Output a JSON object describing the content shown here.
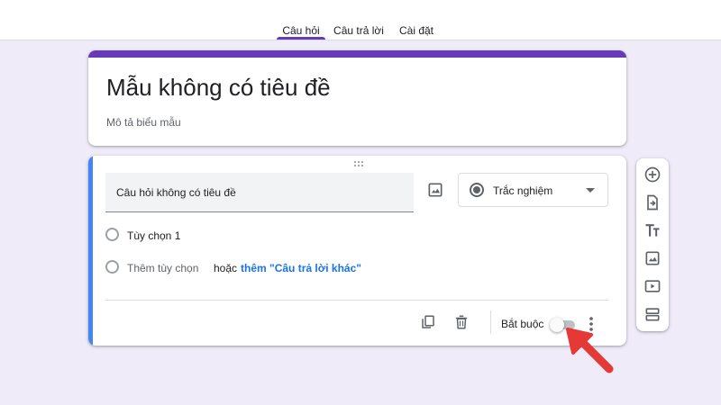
{
  "tabs": [
    {
      "label": "Câu hỏi",
      "active": true
    },
    {
      "label": "Câu trả lời",
      "active": false
    },
    {
      "label": "Cài đặt",
      "active": false
    }
  ],
  "form": {
    "title": "Mẫu không có tiêu đề",
    "description_placeholder": "Mô tả biểu mẫu"
  },
  "question": {
    "title_placeholder": "Câu hỏi không có tiêu đề",
    "type": "Trắc nghiệm",
    "options": [
      "Tùy chọn 1"
    ],
    "add_option": "Thêm tùy chọn",
    "or": "hoặc",
    "add_other": "thêm \"Câu trả lời khác\"",
    "required_label": "Bắt buộc",
    "required": false
  },
  "side_toolbar": {
    "icons": [
      "add-question-icon",
      "import-questions-icon",
      "add-title-icon",
      "add-image-icon",
      "add-video-icon",
      "add-section-icon"
    ]
  },
  "colors": {
    "accent": "#673ab7",
    "active_question_border": "#4285f4",
    "background": "#f0ebf8",
    "link": "#1a73e8",
    "annotation_arrow": "#e53935"
  }
}
